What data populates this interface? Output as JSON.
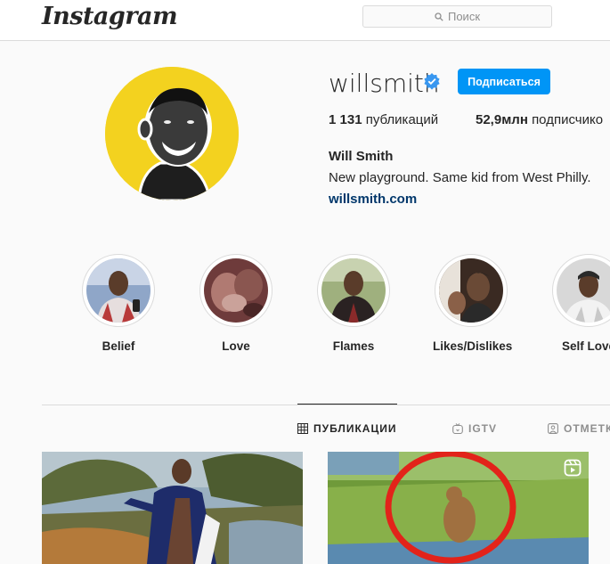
{
  "header": {
    "logo": "Instagram",
    "search": {
      "placeholder": "Поиск",
      "icon": "search-icon"
    }
  },
  "profile": {
    "username": "willsmith",
    "verified": true,
    "follow_label": "Подписаться",
    "stats": [
      {
        "value": "1 131",
        "label": "публикаций"
      },
      {
        "value": "52,9млн",
        "label": "подписчико"
      }
    ],
    "full_name": "Will Smith",
    "bio": "New playground. Same kid from West Philly.",
    "link": "willsmith.com"
  },
  "highlights": [
    {
      "label": "Belief"
    },
    {
      "label": "Love"
    },
    {
      "label": "Flames"
    },
    {
      "label": "Likes/Dislikes"
    },
    {
      "label": "Self Love"
    }
  ],
  "tabs": [
    {
      "label": "ПУБЛИКАЦИИ",
      "icon": "grid-icon",
      "active": true
    },
    {
      "label": "IGTV",
      "icon": "igtv-icon",
      "active": false
    },
    {
      "label": "ОТМЕТК",
      "icon": "tagged-icon",
      "active": false
    }
  ],
  "posts": [
    {
      "type": "photo"
    },
    {
      "type": "reel",
      "icon": "reels-icon"
    }
  ],
  "colors": {
    "accent": "#0095f6",
    "verified": "#3897f0",
    "avatar_bg": "#f3d21f",
    "link": "#00376b"
  }
}
